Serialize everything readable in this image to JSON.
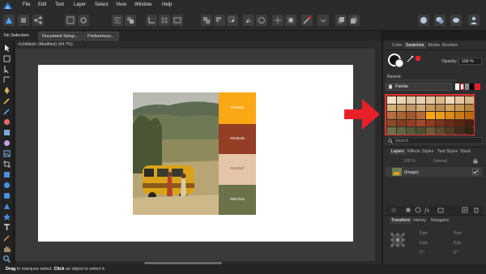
{
  "menu": [
    "File",
    "Edit",
    "Text",
    "Layer",
    "Select",
    "View",
    "Window",
    "Help"
  ],
  "context_bar": {
    "selection": "No Selection",
    "document_setup": "Document Setup...",
    "preferences": "Preferences..."
  },
  "document": {
    "title": "<Untitled> (Modified) (64.7%)"
  },
  "colors": {
    "ui_bg": "#1e1e1e",
    "panel_bg": "#2e2e2e",
    "accent_red": "#e8202a",
    "palette_highlight": "#e23333"
  },
  "swatches": [
    {
      "hex": "#fca815",
      "label": "#fca815",
      "text": "#fca815"
    },
    {
      "hex": "#933e25",
      "label": "#933e25",
      "text": "#933e25"
    },
    {
      "hex": "#e4c5a7",
      "label": "#e4c5a7",
      "text": "#e4c5a7"
    },
    {
      "hex": "#6b724a",
      "label": "#6b724a",
      "text": "#6b724a"
    }
  ],
  "panel": {
    "top_tabs": [
      "Color",
      "Swatches",
      "Stroke",
      "Brushes"
    ],
    "active_top_tab": "Swatches",
    "opacity_label": "Opacity:",
    "opacity_value": "100 %",
    "recent_label": "Recent:",
    "palette_label": "Palette",
    "search_placeholder": "Search",
    "layer_tabs": [
      "Layers",
      "Effects",
      "Styles",
      "Text Styles",
      "Stock"
    ],
    "active_layer_tab": "Layers",
    "layer_opacity": "100 %",
    "blend_mode": "Normal",
    "layer_name": "(Image)",
    "bottom_tabs": [
      "Transform",
      "History",
      "Navigator"
    ],
    "active_bottom_tab": "Transform",
    "transform_fields": [
      "0 px",
      "0 px",
      "0 px",
      "0 px",
      "0 °",
      "0 °"
    ]
  },
  "status": {
    "action1": "Drag",
    "text1": "to marquee select.",
    "action2": "Click",
    "text2": "an object to select it."
  },
  "icons": {
    "arrow": "arrow-right-icon"
  }
}
